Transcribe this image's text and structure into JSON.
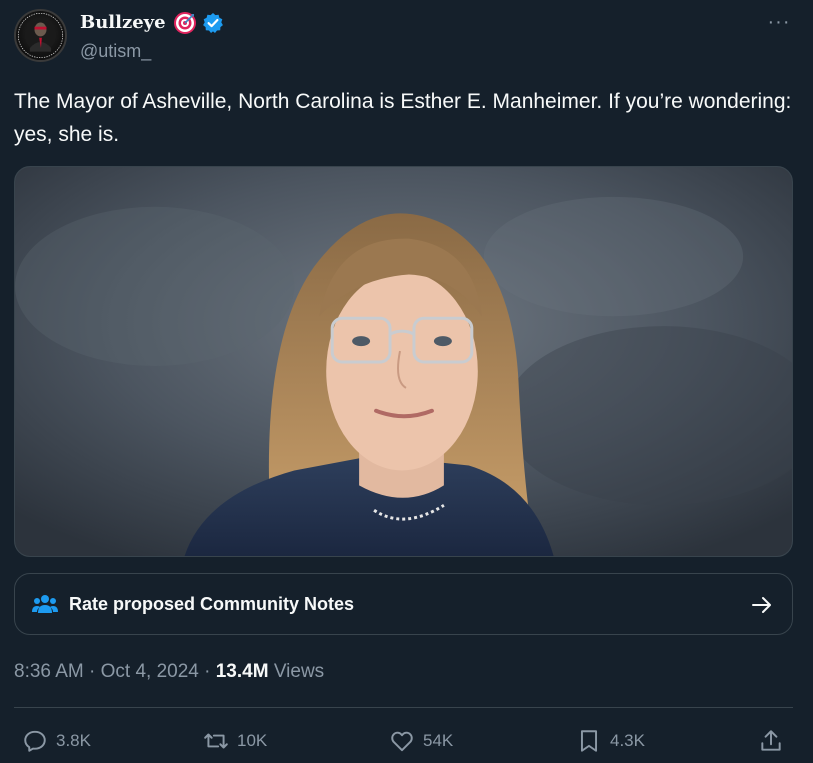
{
  "author": {
    "display_name": "Bullzeye",
    "name_emoji": "direct-hit-target-emoji",
    "verified_icon": "verified-badge-icon",
    "handle": "@utism_",
    "avatar_icon": "avatar-image"
  },
  "more_menu": {
    "icon": "more-options-icon",
    "label": "···"
  },
  "tweet": {
    "text": "The Mayor of Asheville, North Carolina is Esther E. Manheimer. If you’re wondering: yes, she is."
  },
  "media": {
    "kind": "portrait-photo"
  },
  "community_notes": {
    "label": "Rate proposed Community Notes",
    "icon": "people-icon",
    "arrow_icon": "arrow-right-icon"
  },
  "meta": {
    "time": "8:36 AM",
    "separator": " · ",
    "date": "Oct 4, 2024",
    "views_count": "13.4M",
    "views_label": " Views"
  },
  "actions": {
    "replies": "3.8K",
    "retweets": "10K",
    "likes": "54K",
    "bookmarks": "4.3K"
  },
  "colors": {
    "background": "#15202b",
    "text_primary": "#f7f9f9",
    "text_secondary": "#8b98a5",
    "border": "#38444d",
    "accent_blue": "#1d9bf0",
    "emoji_red": "#e0245e"
  }
}
